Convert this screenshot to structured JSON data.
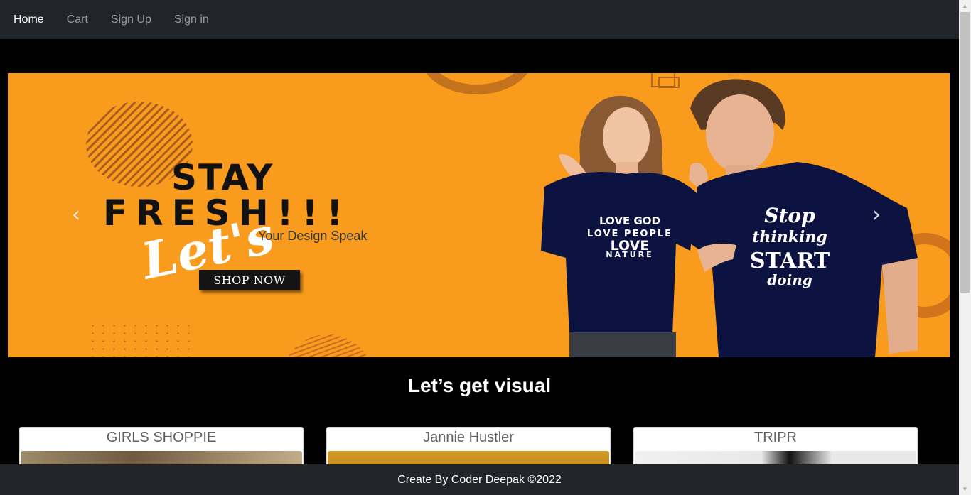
{
  "nav": {
    "items": [
      {
        "label": "Home",
        "active": true
      },
      {
        "label": "Cart",
        "active": false
      },
      {
        "label": "Sign Up",
        "active": false
      },
      {
        "label": "Sign in",
        "active": false
      }
    ]
  },
  "banner": {
    "headline_1": "STAY",
    "headline_2": "FRESH!!!",
    "script_text": "Let's",
    "tagline": "Your Design Speak",
    "cta_label": "SHOP NOW",
    "shirt_left": [
      "LOVE GOD",
      "LOVE PEOPLE",
      "LOVE",
      "NATURE"
    ],
    "shirt_right": [
      "Stop",
      "thinking",
      "START",
      "doing"
    ],
    "prev_icon": "chevron-left-icon",
    "next_icon": "chevron-right-icon"
  },
  "section": {
    "title": "Let’s get visual"
  },
  "cards": [
    {
      "title": "GIRLS SHOPPIE"
    },
    {
      "title": "Jannie Hustler"
    },
    {
      "title": "TRIPR"
    }
  ],
  "footer": {
    "text": "Create By Coder Deepak ©2022"
  },
  "colors": {
    "navbar": "#212529",
    "banner": "#f99b1c",
    "shirt": "#0c1340"
  }
}
